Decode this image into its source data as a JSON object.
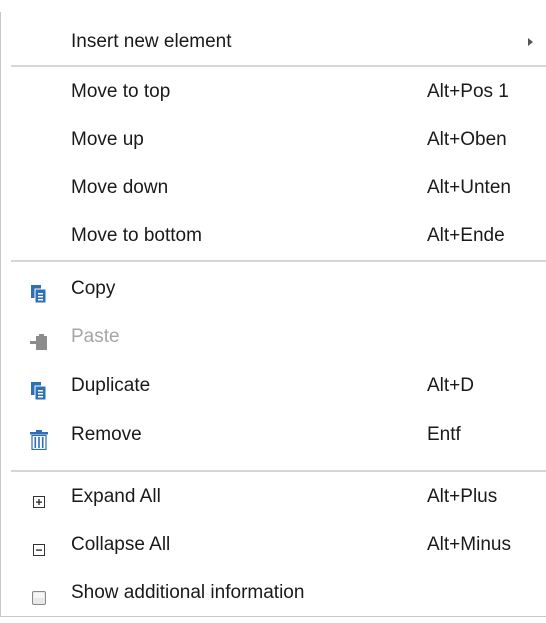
{
  "menu": {
    "insert_new_element": {
      "label": "Insert new element",
      "submenu_icon": "chevron-right-icon"
    },
    "move_to_top": {
      "label": "Move to top",
      "shortcut": "Alt+Pos 1"
    },
    "move_up": {
      "label": "Move up",
      "shortcut": "Alt+Oben"
    },
    "move_down": {
      "label": "Move down",
      "shortcut": "Alt+Unten"
    },
    "move_to_bottom": {
      "label": "Move to bottom",
      "shortcut": "Alt+Ende"
    },
    "copy": {
      "label": "Copy",
      "icon": "copy-icon"
    },
    "paste": {
      "label": "Paste",
      "icon": "paste-icon",
      "disabled": true
    },
    "duplicate": {
      "label": "Duplicate",
      "shortcut": "Alt+D",
      "icon": "duplicate-icon"
    },
    "remove": {
      "label": "Remove",
      "shortcut": "Entf",
      "icon": "trash-icon"
    },
    "expand_all": {
      "label": "Expand All",
      "shortcut": "Alt+Plus",
      "icon": "plus-box-icon"
    },
    "collapse_all": {
      "label": "Collapse All",
      "shortcut": "Alt+Minus",
      "icon": "minus-box-icon"
    },
    "show_additional_information": {
      "label": "Show additional information",
      "icon": "checkbox-icon",
      "checked": false
    }
  },
  "colors": {
    "icon_blue": "#2e6fb5",
    "icon_gray": "#7f7f7f",
    "disabled_text": "#a6a6a6",
    "separator": "#d6d6d6"
  }
}
